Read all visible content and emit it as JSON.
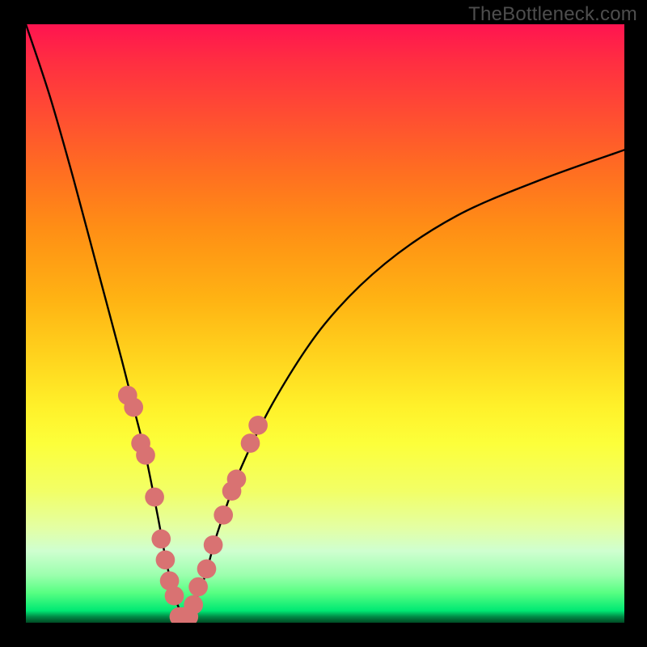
{
  "watermark": "TheBottleneck.com",
  "chart_data": {
    "type": "line",
    "title": "",
    "xlabel": "",
    "ylabel": "",
    "xlim": [
      0,
      100
    ],
    "ylim": [
      0,
      100
    ],
    "series": [
      {
        "name": "bottleneck-curve",
        "x": [
          0,
          4,
          8,
          12,
          16,
          18,
          20,
          22,
          23.5,
          25,
          26.5,
          28,
          30,
          32,
          36,
          42,
          50,
          60,
          72,
          86,
          100
        ],
        "y": [
          100,
          88,
          74,
          59,
          44,
          36,
          28,
          18,
          10,
          4,
          1,
          3,
          8,
          15,
          26,
          38,
          50,
          60,
          68,
          74,
          79
        ]
      }
    ],
    "markers": {
      "name": "highlight-points",
      "color": "#d97272",
      "radius_pct": 1.6,
      "points": [
        {
          "x": 17,
          "y": 38
        },
        {
          "x": 18,
          "y": 36
        },
        {
          "x": 19.2,
          "y": 30
        },
        {
          "x": 20,
          "y": 28
        },
        {
          "x": 21.5,
          "y": 21
        },
        {
          "x": 22.6,
          "y": 14
        },
        {
          "x": 23.3,
          "y": 10.5
        },
        {
          "x": 24,
          "y": 7
        },
        {
          "x": 24.8,
          "y": 4.5
        },
        {
          "x": 25.6,
          "y": 1
        },
        {
          "x": 26.4,
          "y": 1
        },
        {
          "x": 27.2,
          "y": 1
        },
        {
          "x": 28,
          "y": 3
        },
        {
          "x": 28.8,
          "y": 6
        },
        {
          "x": 30.2,
          "y": 9
        },
        {
          "x": 31.3,
          "y": 13
        },
        {
          "x": 33,
          "y": 18
        },
        {
          "x": 34.4,
          "y": 22
        },
        {
          "x": 35.2,
          "y": 24
        },
        {
          "x": 37.5,
          "y": 30
        },
        {
          "x": 38.8,
          "y": 33
        }
      ]
    },
    "gradient_stops": [
      {
        "pos": 0,
        "color": "#ff1450"
      },
      {
        "pos": 24,
        "color": "#ff6c22"
      },
      {
        "pos": 56,
        "color": "#ffd51e"
      },
      {
        "pos": 78,
        "color": "#f2ff66"
      },
      {
        "pos": 95,
        "color": "#57ff82"
      },
      {
        "pos": 100,
        "color": "#004a24"
      }
    ]
  }
}
